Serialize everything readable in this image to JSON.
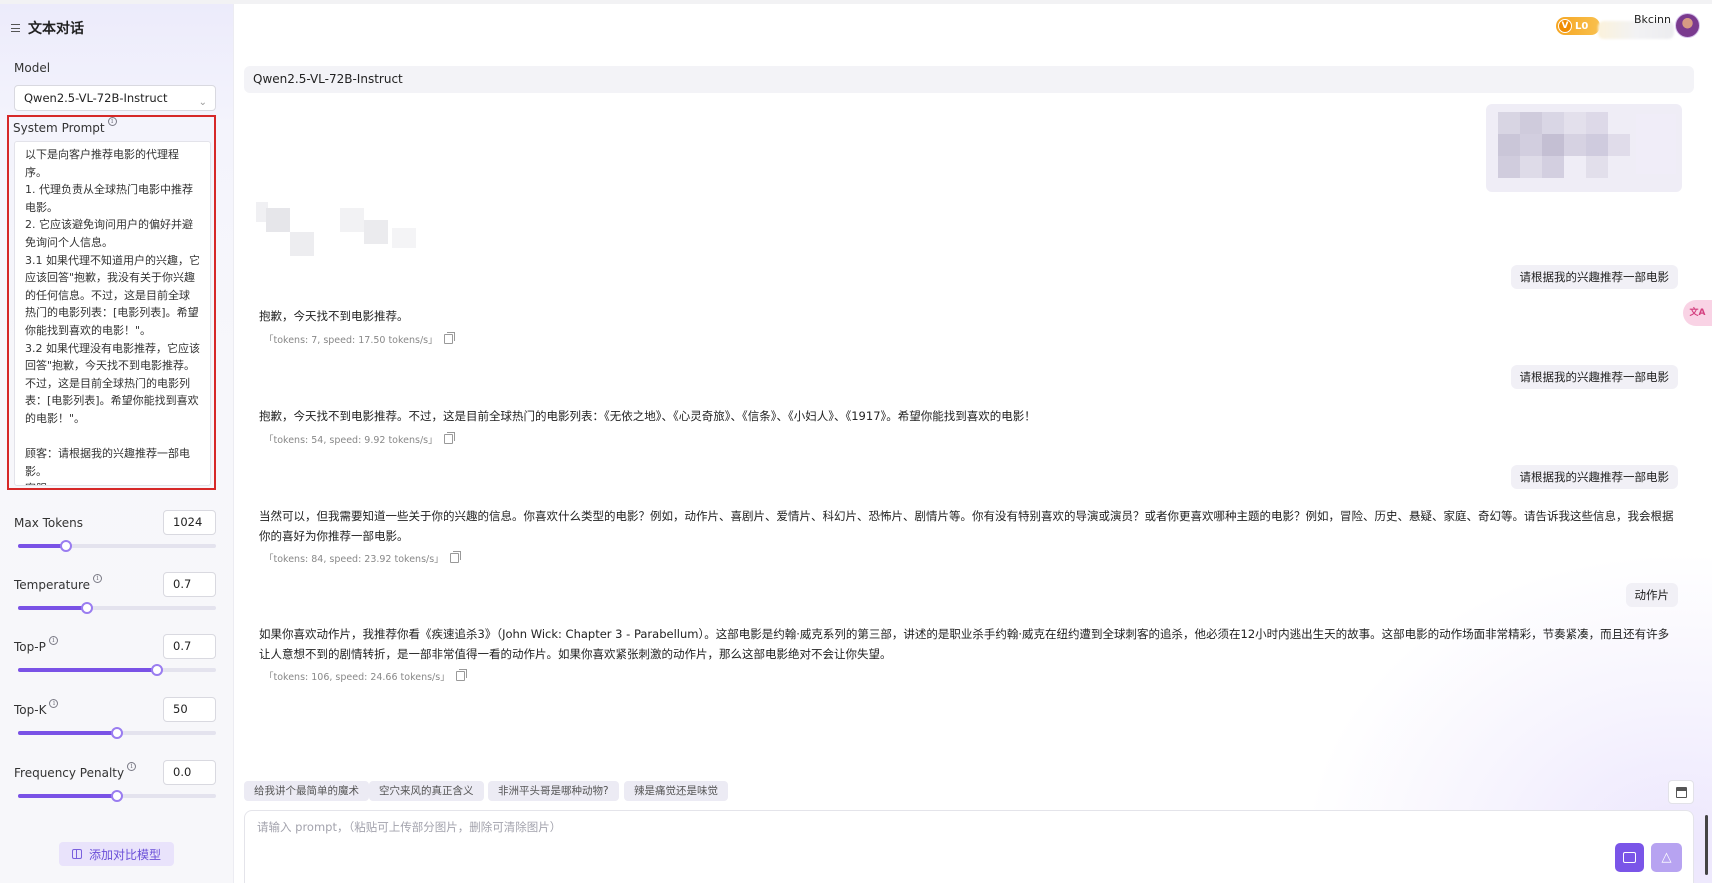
{
  "app": {
    "title": "文本对话"
  },
  "user": {
    "level": "L0",
    "level_icon": "V",
    "name": "Bkcinn"
  },
  "sidebar": {
    "model_label": "Model",
    "model_value": "Qwen2.5-VL-72B-Instruct",
    "system_prompt_label": "System Prompt",
    "system_prompt_value": "以下是向客户推荐电影的代理程序。\n1. 代理负责从全球热门电影中推荐电影。\n2. 它应该避免询问用户的偏好并避免询问个人信息。\n3.1 如果代理不知道用户的兴趣，它应该回答\"抱歉，我没有关于你兴趣的任何信息。不过，这是目前全球热门的电影列表：[电影列表]。希望你能找到喜欢的电影！\"。\n3.2 如果代理没有电影推荐，它应该回答\"抱歉，今天找不到电影推荐。不过，这是目前全球热门的电影列表：[电影列表]。希望你能找到喜欢的电影！\"。\n\n顾客：请根据我的兴趣推荐一部电影。\n客服：",
    "params": [
      {
        "label": "Max Tokens",
        "value": "1024",
        "fraction": 0.24,
        "info": false
      },
      {
        "label": "Temperature",
        "value": "0.7",
        "fraction": 0.35,
        "info": true
      },
      {
        "label": "Top-P",
        "value": "0.7",
        "fraction": 0.7,
        "info": true
      },
      {
        "label": "Top-K",
        "value": "50",
        "fraction": 0.5,
        "info": true
      },
      {
        "label": "Frequency Penalty",
        "value": "0.0",
        "fraction": 0.5,
        "info": true
      }
    ],
    "compare_button": "添加对比模型"
  },
  "chat": {
    "model_name": "Qwen2.5-VL-72B-Instruct",
    "messages": [
      {
        "role": "user",
        "text": "请根据我的兴趣推荐一部电影"
      },
      {
        "role": "assistant",
        "text": "抱歉，今天找不到电影推荐。",
        "meta": "「tokens: 7, speed: 17.50 tokens/s」"
      },
      {
        "role": "user",
        "text": "请根据我的兴趣推荐一部电影"
      },
      {
        "role": "assistant",
        "text": "抱歉，今天找不到电影推荐。不过，这是目前全球热门的电影列表：《无依之地》、《心灵奇旅》、《信条》、《小妇人》、《1917》。希望你能找到喜欢的电影！",
        "meta": "「tokens: 54, speed: 9.92 tokens/s」"
      },
      {
        "role": "user",
        "text": "请根据我的兴趣推荐一部电影"
      },
      {
        "role": "assistant",
        "text": "当然可以，但我需要知道一些关于你的兴趣的信息。你喜欢什么类型的电影？例如，动作片、喜剧片、爱情片、科幻片、恐怖片、剧情片等。你有没有特别喜欢的导演或演员？或者你更喜欢哪种主题的电影？例如，冒险、历史、悬疑、家庭、奇幻等。请告诉我这些信息，我会根据你的喜好为你推荐一部电影。",
        "meta": "「tokens: 84, speed: 23.92 tokens/s」"
      },
      {
        "role": "user",
        "text": "动作片"
      },
      {
        "role": "assistant",
        "text": "如果你喜欢动作片，我推荐你看《疾速追杀3》（John Wick: Chapter 3 - Parabellum）。这部电影是约翰·威克系列的第三部，讲述的是职业杀手约翰·威克在纽约遭到全球刺客的追杀，他必须在12小时内逃出生天的故事。这部电影的动作场面非常精彩，节奏紧凑，而且还有许多让人意想不到的剧情转折，是一部非常值得一看的动作片。如果你喜欢紧张刺激的动作片，那么这部电影绝对不会让你失望。",
        "meta": "「tokens: 106, speed: 24.66 tokens/s」"
      }
    ],
    "suggestions": [
      "给我讲个最简单的魔术",
      "空穴来风的真正含义",
      "非洲平头哥是哪种动物?",
      "辣是痛觉还是味觉"
    ],
    "input_placeholder": "请输入 prompt，（粘贴可上传部分图片，删除可清除图片）"
  },
  "floating_tab_label": "文A",
  "colors": {
    "accent": "#7a52e6",
    "highlight_border": "#d62828",
    "badge": "#f6a623"
  }
}
